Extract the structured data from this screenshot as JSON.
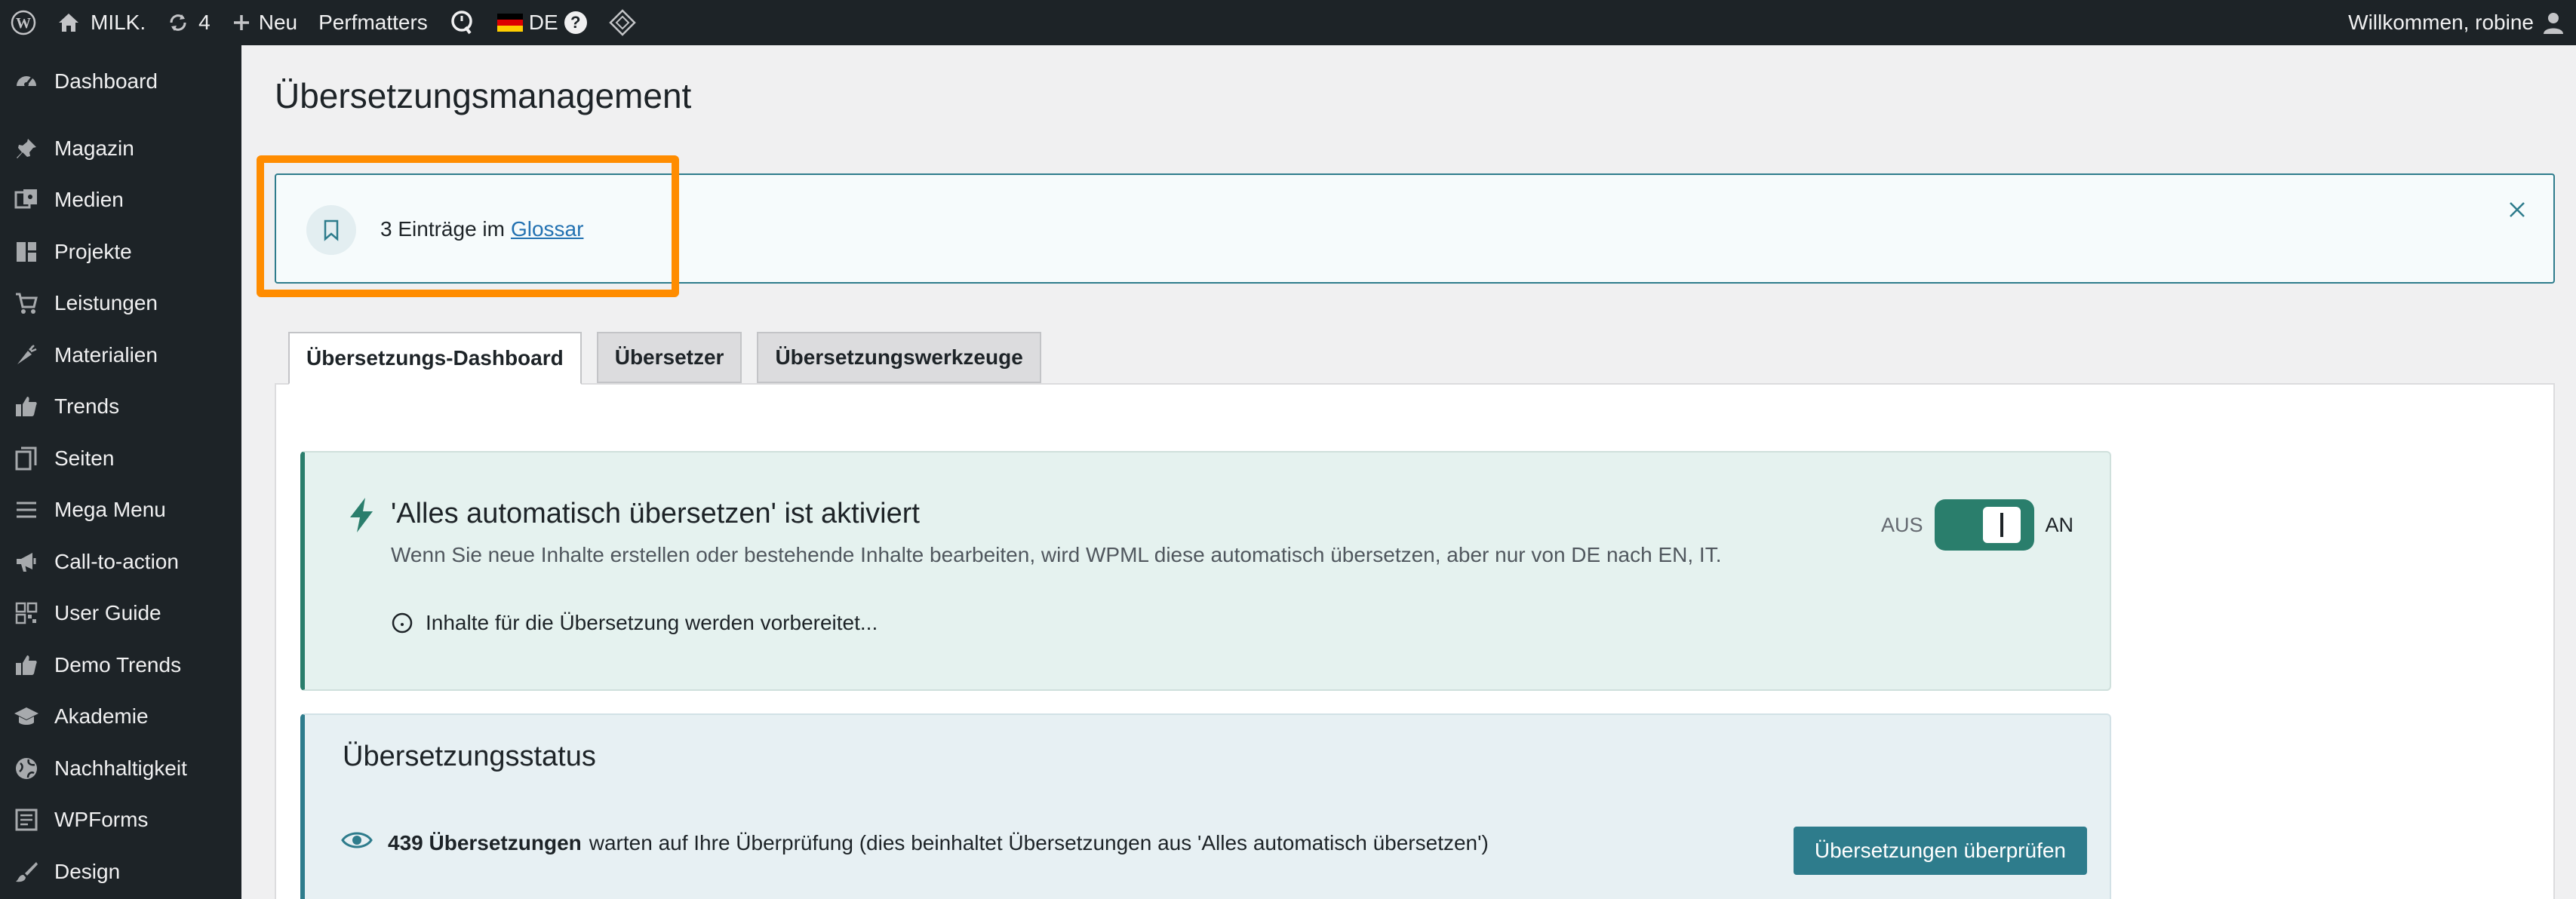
{
  "adminbar": {
    "site_name": "MILK.",
    "updates_count": "4",
    "new_label": "Neu",
    "perfmatters_label": "Perfmatters",
    "language_label": "DE",
    "language_help": "?",
    "greeting": "Willkommen, robine"
  },
  "sidebar": {
    "items": [
      {
        "label": "Dashboard",
        "icon": "dashboard-icon"
      },
      {
        "label": "Magazin",
        "icon": "pin-icon"
      },
      {
        "label": "Medien",
        "icon": "media-icon"
      },
      {
        "label": "Projekte",
        "icon": "layout-icon"
      },
      {
        "label": "Leistungen",
        "icon": "cart-icon"
      },
      {
        "label": "Materialien",
        "icon": "carrot-icon"
      },
      {
        "label": "Trends",
        "icon": "thumbs-up-icon"
      },
      {
        "label": "Seiten",
        "icon": "pages-icon"
      },
      {
        "label": "Mega Menu",
        "icon": "menu-icon"
      },
      {
        "label": "Call-to-action",
        "icon": "megaphone-icon"
      },
      {
        "label": "User Guide",
        "icon": "grid-icon"
      },
      {
        "label": "Demo Trends",
        "icon": "thumbs-up-icon"
      },
      {
        "label": "Akademie",
        "icon": "graduation-cap-icon"
      },
      {
        "label": "Nachhaltigkeit",
        "icon": "globe-icon"
      },
      {
        "label": "WPForms",
        "icon": "forms-icon"
      },
      {
        "label": "Design",
        "icon": "brush-icon"
      }
    ]
  },
  "main": {
    "page_title": "Übersetzungsmanagement",
    "notice": {
      "text": "3 Einträge im",
      "link": "Glossar"
    },
    "tabs": [
      {
        "label": "Übersetzungs-Dashboard",
        "active": true
      },
      {
        "label": "Übersetzer",
        "active": false
      },
      {
        "label": "Übersetzungswerkzeuge",
        "active": false
      }
    ],
    "auto_card": {
      "title": "'Alles automatisch übersetzen' ist aktiviert",
      "description": "Wenn Sie neue Inhalte erstellen oder bestehende Inhalte bearbeiten, wird WPML diese automatisch übersetzen, aber nur von DE nach EN, IT.",
      "preparing": "Inhalte für die Übersetzung werden vorbereitet...",
      "toggle_off": "AUS",
      "toggle_on": "AN",
      "toggle_state": true
    },
    "status_card": {
      "title": "Übersetzungsstatus",
      "count_text": "439 Übersetzungen",
      "rest_text": "warten auf Ihre Überprüfung (dies beinhaltet Übersetzungen aus 'Alles automatisch übersetzen')",
      "button": "Übersetzungen überprüfen"
    }
  },
  "colors": {
    "adminbar_bg": "#1d2327",
    "accent_teal": "#2e7c8c",
    "toggle_green": "#2a7e6c",
    "highlight_orange": "#ff8c00"
  }
}
